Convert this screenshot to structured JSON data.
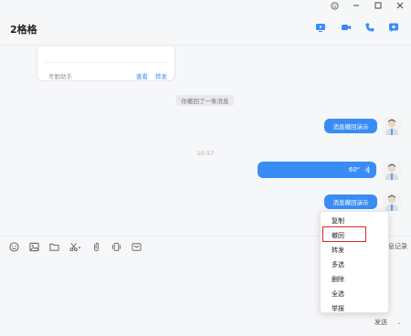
{
  "window": {
    "controls": [
      "smiley-icon",
      "minimize-icon",
      "maximize-icon",
      "close-icon"
    ]
  },
  "header": {
    "title": "2格格",
    "actions": [
      "screen-share-icon",
      "video-call-icon",
      "voice-call-icon",
      "add-icon"
    ]
  },
  "card": {
    "source": "考勤助手",
    "action_view": "查看",
    "action_forward": "转发"
  },
  "messages": {
    "recall_notice": "你撤回了一条消息",
    "recall_demo_1": "消息撤回演示",
    "timestamp": "10:57",
    "voice_duration": "60\"",
    "recall_demo_2": "消息撤回演示"
  },
  "toolbar": {
    "tools": [
      "emoji-icon",
      "image-icon",
      "folder-icon",
      "screenshot-icon",
      "clip-icon",
      "shake-icon",
      "message-icon"
    ],
    "history_label": "息记录"
  },
  "composer": {
    "send_label": "发送"
  },
  "context_menu": {
    "items": [
      "复制",
      "撤回",
      "转发",
      "多选",
      "删除",
      "全选",
      "举报"
    ],
    "highlighted": "撤回",
    "highlight_color": "#d9252b"
  },
  "colors": {
    "accent": "#3a8cf5",
    "background": "#f6f7f9"
  }
}
